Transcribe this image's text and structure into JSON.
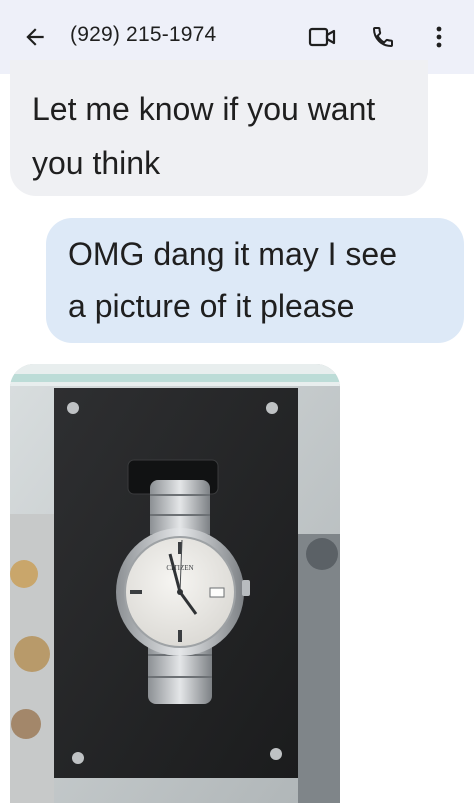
{
  "header": {
    "title": "(929) 215-1974",
    "icons": [
      "arrow-back-icon",
      "video-call-icon",
      "phone-icon",
      "more-vert-icon"
    ]
  },
  "messages": [
    {
      "direction": "incoming",
      "lines": [
        "Let me know if you want",
        "you think"
      ]
    },
    {
      "direction": "outgoing",
      "lines": [
        "OMG dang it may I see",
        "a picture of it please"
      ]
    }
  ],
  "attachment": {
    "type": "photo",
    "watch_brand_text": "CITIZEN"
  },
  "colors": {
    "header_bg": "#eef0f9",
    "incoming_bubble": "#eff0f3",
    "outgoing_bubble": "#dde9f7"
  }
}
